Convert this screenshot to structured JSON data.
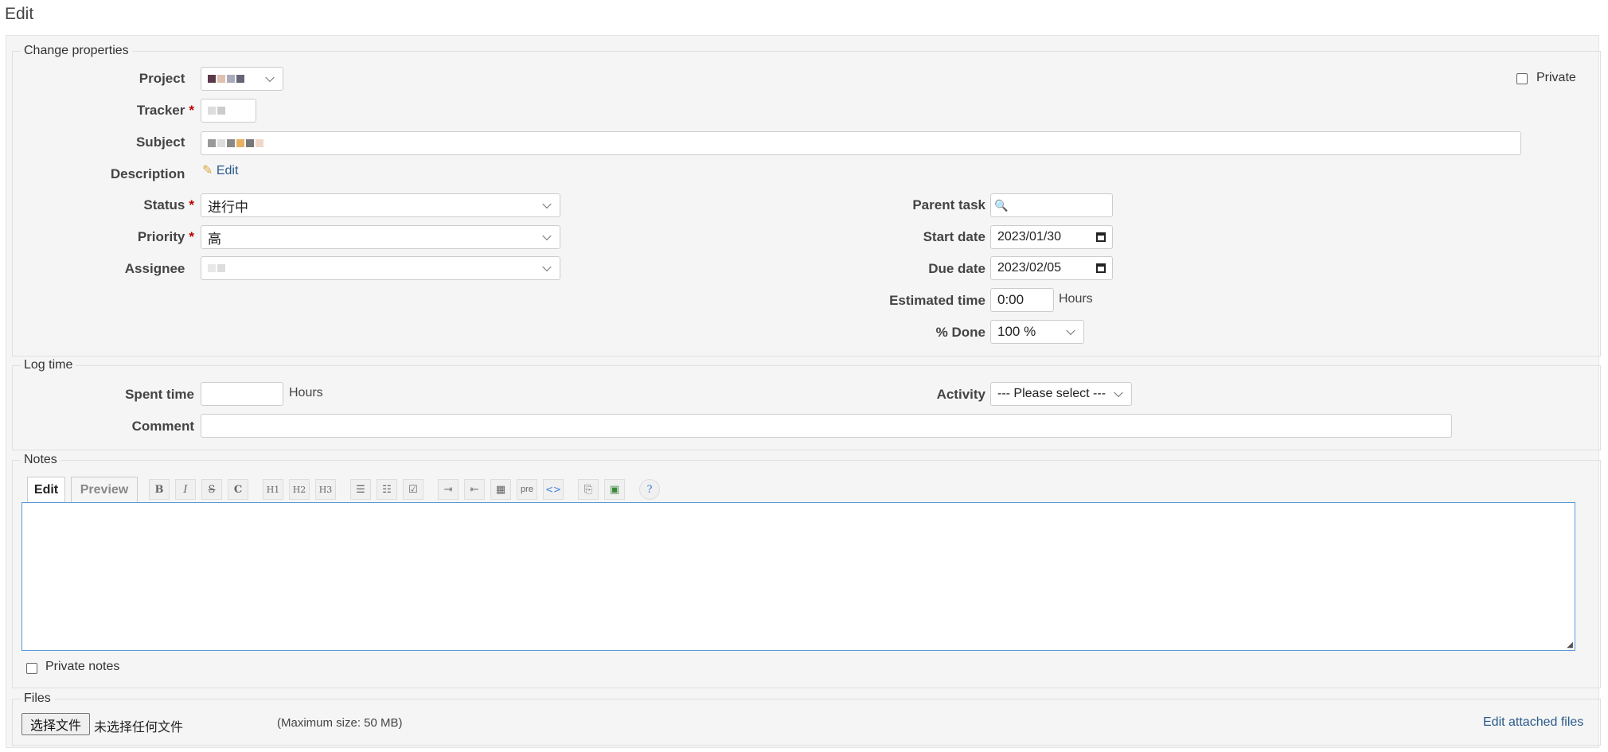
{
  "page": {
    "title": "Edit"
  },
  "change_properties": {
    "legend": "Change properties",
    "project_label": "Project",
    "tracker_label": "Tracker",
    "subject_label": "Subject",
    "description_label": "Description",
    "description_edit": "Edit",
    "private_label": "Private",
    "status_label": "Status",
    "status_value": "进行中",
    "priority_label": "Priority",
    "priority_value": "高",
    "assignee_label": "Assignee",
    "parent_task_label": "Parent task",
    "start_date_label": "Start date",
    "start_date_value": "2023/01/30",
    "due_date_label": "Due date",
    "due_date_value": "2023/02/05",
    "estimated_time_label": "Estimated time",
    "estimated_time_value": "0:00",
    "estimated_time_unit": "Hours",
    "done_label": "% Done",
    "done_value": "100 %"
  },
  "log_time": {
    "legend": "Log time",
    "spent_time_label": "Spent time",
    "spent_time_unit": "Hours",
    "activity_label": "Activity",
    "activity_value": "--- Please select ---",
    "comment_label": "Comment"
  },
  "notes": {
    "legend": "Notes",
    "tab_edit": "Edit",
    "tab_preview": "Preview",
    "toolbar": [
      "B",
      "I",
      "S",
      "C",
      "H1",
      "H2",
      "H3",
      "ul",
      "ol",
      "task",
      "indent",
      "outdent",
      "table",
      "pre",
      "<>",
      "link",
      "image",
      "?"
    ],
    "private_notes_label": "Private notes"
  },
  "files": {
    "legend": "Files",
    "choose_button": "选择文件",
    "no_file_text": "未选择任何文件",
    "max_size": "(Maximum size: 50 MB)",
    "edit_attached": "Edit attached files"
  },
  "colors": {
    "link": "#2a5a8a",
    "required": "#bb0000",
    "panel": "#f5f5f5"
  }
}
